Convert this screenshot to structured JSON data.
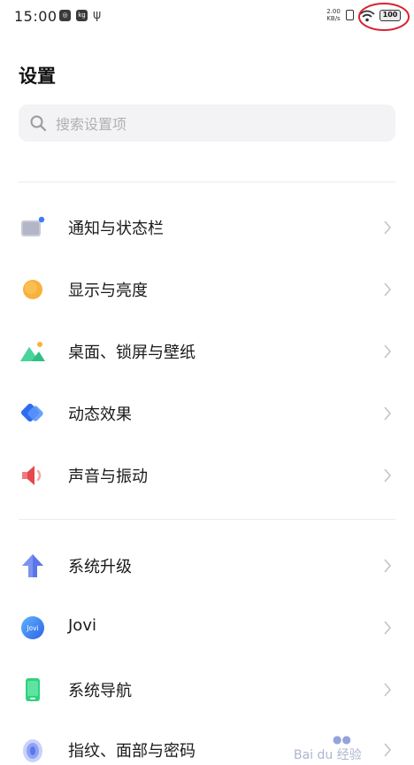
{
  "status_bar": {
    "time": "15:00",
    "icon_a": "◎",
    "icon_b": "kg",
    "usb_glyph": "ψ",
    "net_speed_value": "2.00",
    "net_speed_unit": "KB/s",
    "battery": "100",
    "highlight_color": "#d9232d"
  },
  "header": {
    "title": "设置"
  },
  "search": {
    "placeholder": "搜索设置项",
    "value": ""
  },
  "groups": [
    {
      "items": [
        {
          "label": "通知与状态栏",
          "icon": "notification-statusbar-icon"
        },
        {
          "label": "显示与亮度",
          "icon": "display-brightness-icon"
        },
        {
          "label": "桌面、锁屏与壁纸",
          "icon": "wallpaper-icon"
        },
        {
          "label": "动态效果",
          "icon": "motion-effects-icon"
        },
        {
          "label": "声音与振动",
          "icon": "sound-vibration-icon"
        }
      ]
    },
    {
      "items": [
        {
          "label": "系统升级",
          "icon": "system-update-icon"
        },
        {
          "label": "Jovi",
          "icon": "jovi-icon",
          "icon_text": "Jovi"
        },
        {
          "label": "系统导航",
          "icon": "system-navigation-icon"
        },
        {
          "label": "指纹、面部与密码",
          "icon": "fingerprint-icon"
        }
      ]
    }
  ],
  "watermark": {
    "text": "Bai du 经验"
  },
  "colors": {
    "accent_blue": "#3d7bf7",
    "display_orange": "#f8b13a",
    "sound_red": "#e5484d",
    "nav_green": "#2fd27d",
    "update_blue": "#5b76e8"
  }
}
